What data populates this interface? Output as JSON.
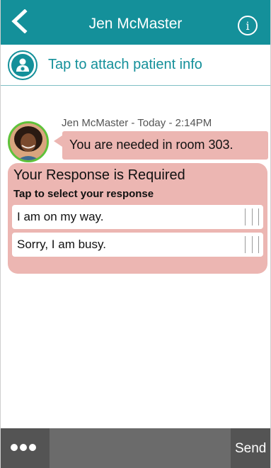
{
  "header": {
    "title": "Jen McMaster",
    "back_icon": "chevron-left-icon",
    "info_icon": "info-icon",
    "info_glyph": "i"
  },
  "attach": {
    "label": "Tap to attach patient info",
    "icon": "patient-icon"
  },
  "message": {
    "meta": "Jen McMaster - Today - 2:14PM",
    "text": "You are needed in room 303."
  },
  "response": {
    "title": "Your Response is Required",
    "subtitle": "Tap to select your response",
    "options": [
      {
        "label": "I am on my way."
      },
      {
        "label": "Sorry, I am busy."
      }
    ]
  },
  "composer": {
    "more_icon": "more-dots-icon",
    "placeholder": "",
    "send_label": "Send"
  },
  "colors": {
    "header_bg": "#14909a",
    "accent": "#14909a",
    "bubble_bg": "#ecb6b2",
    "bottom_bar_bg": "#545454",
    "avatar_ring": "#5ec23a"
  }
}
